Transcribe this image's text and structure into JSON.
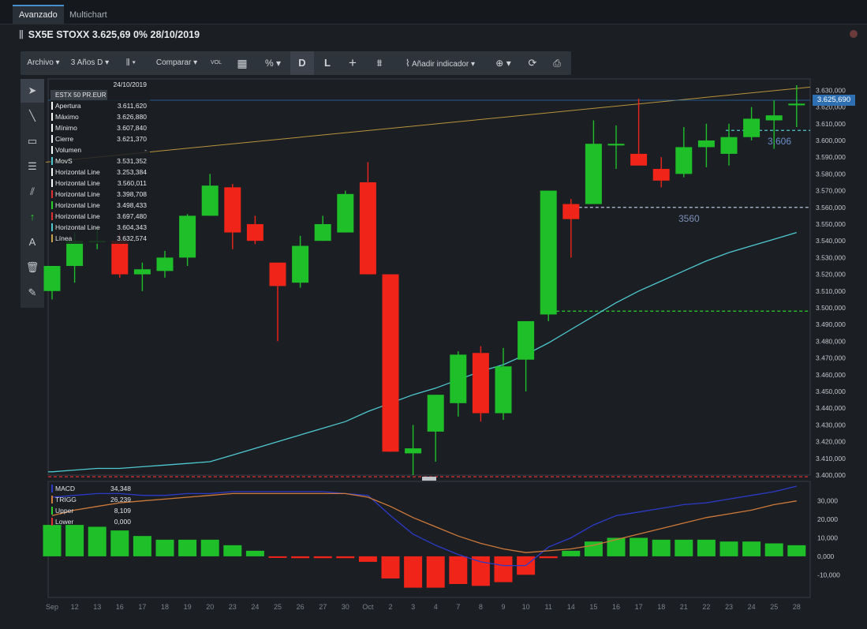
{
  "tabs": [
    {
      "label": "Avanzado",
      "active": true
    },
    {
      "label": "Multichart",
      "active": false
    }
  ],
  "instrument": {
    "title": "SX5E STOXX 3.625,69 0% 28/10/2019"
  },
  "toolbar": {
    "file": "Archivo ▾",
    "period": "3 Años D ▾",
    "chart_type": "▾",
    "compare": "Comparar ▾",
    "vol": "VOL",
    "percent": "% ▾",
    "d": "D",
    "l": "L",
    "add_indicator": "Añadir indicador ▾",
    "zoom": "▾"
  },
  "info_panel": {
    "date": "24/10/2019",
    "symbol": "ESTX 50 PR.EUR",
    "rows": [
      {
        "label": "Apertura",
        "value": "3.611,620",
        "color": "#ffffff"
      },
      {
        "label": "Máximo",
        "value": "3.626,880",
        "color": "#ffffff"
      },
      {
        "label": "Mínimo",
        "value": "3.607,840",
        "color": "#ffffff"
      },
      {
        "label": "Cierre",
        "value": "3.621,370",
        "color": "#ffffff"
      },
      {
        "label": "Volumen",
        "value": "-",
        "color": "#ffffff"
      },
      {
        "label": "MovS",
        "value": "3.531,352",
        "color": "#4ec9d0"
      },
      {
        "label": "Horizontal Line",
        "value": "3.253,384",
        "color": "#ffffff"
      },
      {
        "label": "Horizontal Line",
        "value": "3.560,011",
        "color": "#ffffff"
      },
      {
        "label": "Horizontal Line",
        "value": "3.398,708",
        "color": "#e03030"
      },
      {
        "label": "Horizontal Line",
        "value": "3.498,433",
        "color": "#2bd12b"
      },
      {
        "label": "Horizontal Line",
        "value": "3.697,480",
        "color": "#e03030"
      },
      {
        "label": "Horizontal Line",
        "value": "3.604,343",
        "color": "#4ec9d0"
      },
      {
        "label": "Línea",
        "value": "3.632,574",
        "color": "#c8a24a"
      }
    ]
  },
  "macd_panel": {
    "rows": [
      {
        "label": "MACD",
        "value": "34,348",
        "color": "#2b3bc8"
      },
      {
        "label": "TRIGG",
        "value": "26,239",
        "color": "#d07a3a"
      },
      {
        "label": "Upper",
        "value": "8,109",
        "color": "#2bd12b"
      },
      {
        "label": "Lower",
        "value": "0,000",
        "color": "#e03030"
      }
    ]
  },
  "price_label": "3.625,690",
  "line_labels": {
    "l3606": "3.606",
    "l3560": "3560"
  },
  "colors": {
    "up": "#1fbf2a",
    "down": "#f02418",
    "ma": "#4ec9d0",
    "trend": "#b8943c",
    "bg": "#1b1e23"
  },
  "chart_data": {
    "type": "candlestick",
    "x_labels": [
      "Sep",
      "12",
      "13",
      "16",
      "17",
      "18",
      "19",
      "20",
      "23",
      "24",
      "25",
      "26",
      "27",
      "30",
      "Oct",
      "2",
      "3",
      "4",
      "7",
      "8",
      "9",
      "10",
      "11",
      "14",
      "15",
      "16",
      "17",
      "18",
      "21",
      "22",
      "23",
      "24",
      "25",
      "28"
    ],
    "y_ticks": [
      "3.630,000",
      "3.620,000",
      "3.610,000",
      "3.600,000",
      "3.590,000",
      "3.580,000",
      "3.570,000",
      "3.560,000",
      "3.550,000",
      "3.540,000",
      "3.530,000",
      "3.520,000",
      "3.510,000",
      "3.500,000",
      "3.490,000",
      "3.480,000",
      "3.470,000",
      "3.460,000",
      "3.450,000",
      "3.440,000",
      "3.430,000",
      "3.420,000",
      "3.410,000",
      "3.400,000"
    ],
    "ylim": [
      3400,
      3633
    ],
    "candles": [
      {
        "o": 3510,
        "h": 3525,
        "c": 3525,
        "l": 3505
      },
      {
        "o": 3525,
        "h": 3545,
        "c": 3540,
        "l": 3515
      },
      {
        "o": 3540,
        "h": 3548,
        "c": 3540,
        "l": 3535
      },
      {
        "o": 3540,
        "h": 3545,
        "c": 3520,
        "l": 3518
      },
      {
        "o": 3520,
        "h": 3527,
        "c": 3523,
        "l": 3510
      },
      {
        "o": 3522,
        "h": 3534,
        "c": 3530,
        "l": 3518
      },
      {
        "o": 3530,
        "h": 3556,
        "c": 3555,
        "l": 3525
      },
      {
        "o": 3555,
        "h": 3580,
        "c": 3573,
        "l": 3555
      },
      {
        "o": 3572,
        "h": 3574,
        "c": 3545,
        "l": 3535
      },
      {
        "o": 3550,
        "h": 3555,
        "c": 3540,
        "l": 3538
      },
      {
        "o": 3527,
        "h": 3527,
        "c": 3513,
        "l": 3480
      },
      {
        "o": 3515,
        "h": 3543,
        "c": 3537,
        "l": 3512
      },
      {
        "o": 3540,
        "h": 3555,
        "c": 3550,
        "l": 3540
      },
      {
        "o": 3545,
        "h": 3570,
        "c": 3568,
        "l": 3545
      },
      {
        "o": 3575,
        "h": 3587,
        "c": 3520,
        "l": 3520
      },
      {
        "o": 3520,
        "h": 3520,
        "c": 3414,
        "l": 3414
      },
      {
        "o": 3413,
        "h": 3430,
        "c": 3416,
        "l": 3400
      },
      {
        "o": 3426,
        "h": 3448,
        "c": 3448,
        "l": 3408
      },
      {
        "o": 3443,
        "h": 3474,
        "c": 3472,
        "l": 3435
      },
      {
        "o": 3473,
        "h": 3477,
        "c": 3437,
        "l": 3432
      },
      {
        "o": 3437,
        "h": 3476,
        "c": 3465,
        "l": 3433
      },
      {
        "o": 3469,
        "h": 3490,
        "c": 3492,
        "l": 3450
      },
      {
        "o": 3496,
        "h": 3570,
        "c": 3570,
        "l": 3492
      },
      {
        "o": 3562,
        "h": 3565,
        "c": 3553,
        "l": 3530
      },
      {
        "o": 3562,
        "h": 3612,
        "c": 3598,
        "l": 3562
      },
      {
        "o": 3597,
        "h": 3609,
        "c": 3598,
        "l": 3583
      },
      {
        "o": 3592,
        "h": 3625,
        "c": 3585,
        "l": 3585
      },
      {
        "o": 3583,
        "h": 3590,
        "c": 3576,
        "l": 3572
      },
      {
        "o": 3580,
        "h": 3608,
        "c": 3596,
        "l": 3578
      },
      {
        "o": 3596,
        "h": 3610,
        "c": 3600,
        "l": 3584
      },
      {
        "o": 3592,
        "h": 3610,
        "c": 3602,
        "l": 3585
      },
      {
        "o": 3602,
        "h": 3620,
        "c": 3613,
        "l": 3600
      },
      {
        "o": 3612,
        "h": 3624,
        "c": 3615,
        "l": 3595
      },
      {
        "o": 3621,
        "h": 3633,
        "c": 3622,
        "l": 3608
      }
    ],
    "ma_values": [
      3402,
      3403,
      3404,
      3404,
      3405,
      3406,
      3407,
      3408,
      3412,
      3416,
      3420,
      3424,
      3428,
      3432,
      3438,
      3443,
      3448,
      3452,
      3457,
      3462,
      3466,
      3472,
      3479,
      3487,
      3495,
      3503,
      3510,
      3516,
      3522,
      3528,
      3533,
      3537,
      3541,
      3545
    ],
    "horizontal_lines": [
      {
        "value": 3606,
        "color": "#4ec9d0",
        "from": 30
      },
      {
        "value": 3560,
        "color": "#bcc6dd",
        "from": 23
      },
      {
        "value": 3498,
        "color": "#2bd12b",
        "from": 22
      },
      {
        "value": 3399,
        "color": "#e03030",
        "from": 0
      }
    ],
    "trendline": {
      "from": [
        0,
        3587
      ],
      "to": [
        33,
        3630
      ]
    },
    "macd": {
      "y_ticks": [
        "30,000",
        "20,000",
        "10,000",
        "0,000",
        "-10,000"
      ],
      "ylim": [
        -18,
        38
      ],
      "histogram": [
        17,
        17,
        16,
        14,
        11,
        9,
        9,
        9,
        6,
        3,
        -0.5,
        -1,
        -1,
        -1,
        -3,
        -12,
        -17,
        -17,
        -15,
        -16,
        -14,
        -10,
        -1,
        3,
        8,
        10,
        10,
        9,
        9,
        9,
        8,
        8,
        7,
        6
      ],
      "macd_line": [
        32,
        33,
        34,
        34,
        33,
        33,
        34,
        34,
        35,
        35,
        35,
        35,
        35,
        34,
        33,
        22,
        12,
        6,
        1,
        -3,
        -5,
        -5,
        5,
        10,
        17,
        22,
        24,
        26,
        28,
        29,
        31,
        33,
        35,
        38
      ],
      "trigg_line": [
        22,
        25,
        27,
        29,
        30,
        31,
        32,
        33,
        34,
        34,
        34,
        34,
        34,
        34,
        32,
        27,
        21,
        16,
        11,
        7,
        4,
        2,
        3,
        4,
        6,
        9,
        12,
        15,
        18,
        21,
        23,
        25,
        28,
        30
      ]
    }
  }
}
